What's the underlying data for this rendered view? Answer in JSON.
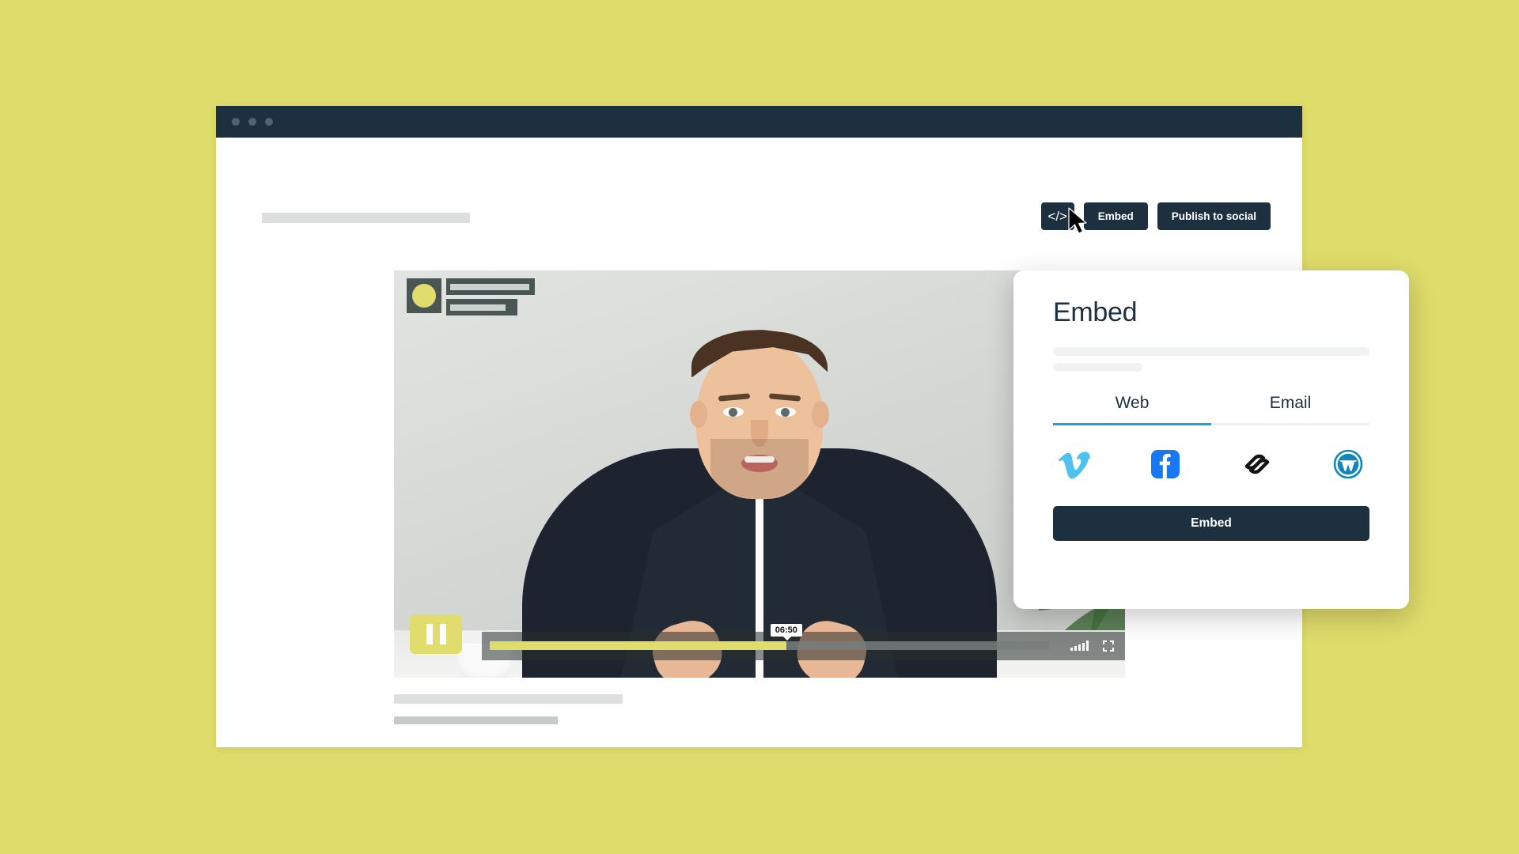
{
  "theme": {
    "background": "#dedc6a",
    "dark_navy": "#1d3040",
    "accent_yellow": "#e0dd6d",
    "tab_active_blue": "#13a5e8"
  },
  "browser": {
    "traffic_lights": [
      "dot-red",
      "dot-yellow",
      "dot-green"
    ],
    "title_placeholder": ""
  },
  "toolbar": {
    "code_button_label": "</>",
    "embed_label": "Embed",
    "publish_label": "Publish to social"
  },
  "video": {
    "overlay_badge": {
      "avatar": "avatar-circle",
      "line_1": "",
      "line_2": ""
    },
    "controls": {
      "state": "playing",
      "pause_label": "Pause",
      "current_time": "06:50",
      "progress_percent": 53,
      "volume_icon": "volume-icon",
      "fullscreen_icon": "fullscreen-icon"
    }
  },
  "embed_panel": {
    "title": "Embed",
    "tabs": [
      {
        "label": "Web",
        "active": true
      },
      {
        "label": "Email",
        "active": false
      }
    ],
    "socials": [
      {
        "name": "vimeo",
        "color": "#4EC1F0"
      },
      {
        "name": "facebook",
        "color": "#1877F2"
      },
      {
        "name": "squarespace",
        "color": "#141414"
      },
      {
        "name": "wordpress",
        "color": "#1087B8"
      }
    ],
    "cta_label": "Embed"
  },
  "cursor": {
    "type": "arrow-pointer"
  }
}
